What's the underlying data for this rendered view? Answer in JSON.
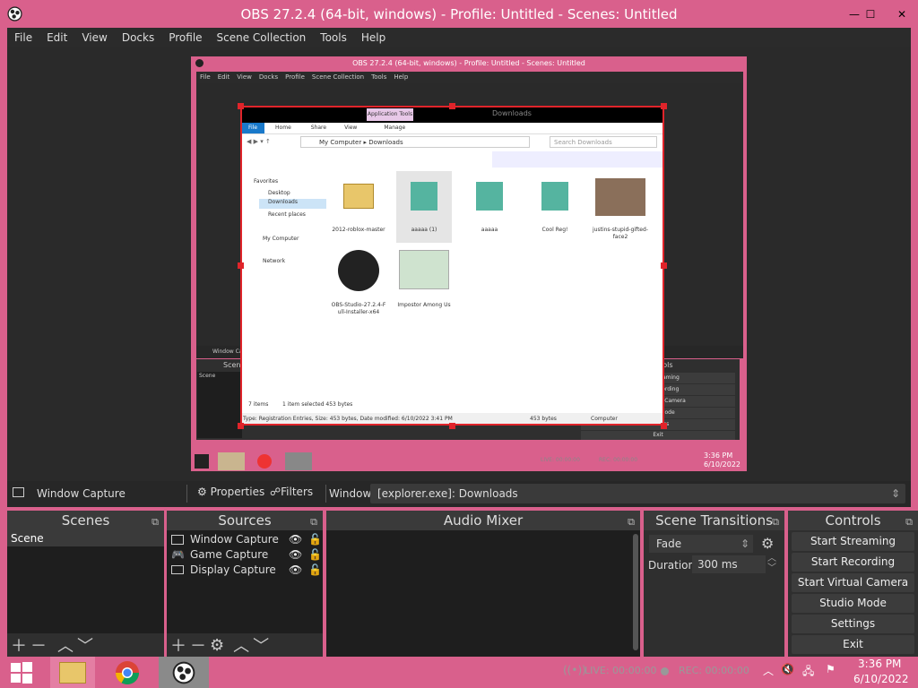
{
  "window": {
    "title": "OBS 27.2.4 (64-bit, windows) - Profile: Untitled - Scenes: Untitled",
    "minimize": "—",
    "maximize": "☐",
    "close": "✕"
  },
  "menu": [
    "File",
    "Edit",
    "View",
    "Docks",
    "Profile",
    "Scene Collection",
    "Tools",
    "Help"
  ],
  "preview": {
    "nested_title": "OBS 27.2.4 (64-bit, windows) - Profile: Untitled - Scenes: Untitled",
    "nested_menu": [
      "File",
      "Edit",
      "View",
      "Docks",
      "Profile",
      "Scene Collection",
      "Tools",
      "Help"
    ],
    "nested_window_capture": "Window Ca",
    "nested_scenes": "Scen",
    "nested_scene_item": "Scene",
    "nested_controls_title": "Controls",
    "nested_controls": [
      "Start Streaming",
      "Start Recording",
      "Start Virtual Camera",
      "Studio Mode",
      "Settings",
      "Exit"
    ],
    "nested_time": "3:36 PM",
    "nested_date": "6/10/2022",
    "nested_live": "LIVE: 00:00:00",
    "nested_rec": "REC: 00:00:00",
    "ribbon_context": "Application Tools",
    "ribbon_context2": "Downloads",
    "ribbon_tabs": [
      "File",
      "Home",
      "Share",
      "View",
      "Manage"
    ],
    "path_computer": "My Computer",
    "path_folder": "Downloads",
    "search_placeholder": "Search Downloads",
    "nav_favorites": "Favorites",
    "nav_items": [
      "Desktop",
      "Downloads",
      "Recent places"
    ],
    "nav_computer": "My Computer",
    "nav_network": "Network",
    "files": [
      {
        "name": "2012-roblox-master",
        "kind": "zip"
      },
      {
        "name": "aaaaa (1)",
        "kind": "reg"
      },
      {
        "name": "aaaaa",
        "kind": "reg"
      },
      {
        "name": "Cool Reg!",
        "kind": "reg"
      },
      {
        "name": "justins-stupid-gifted-face2",
        "kind": "photo"
      },
      {
        "name": "OBS-Studio-27.2.4-Full-Installer-x64",
        "kind": "obs"
      },
      {
        "name": "Impostor Among Us",
        "kind": "image"
      }
    ],
    "status_items": "7 items",
    "status_selected": "1 item selected  453 bytes",
    "details_bar": "Type: Registration Entries, Size: 453 bytes, Date modified: 6/10/2022 3:41 PM",
    "details_size": "453 bytes",
    "details_location": "Computer"
  },
  "sourcebar": {
    "source_name": "Window Capture",
    "properties": "Properties",
    "filters": "Filters",
    "window_label": "Window",
    "window_value": "[explorer.exe]: Downloads"
  },
  "scenes": {
    "title": "Scenes",
    "items": [
      "Scene"
    ]
  },
  "sources": {
    "title": "Sources",
    "items": [
      {
        "name": "Window Capture",
        "icon": "window-icon"
      },
      {
        "name": "Game Capture",
        "icon": "gamepad-icon"
      },
      {
        "name": "Display Capture",
        "icon": "monitor-icon"
      }
    ]
  },
  "mixer": {
    "title": "Audio Mixer"
  },
  "transitions": {
    "title": "Scene Transitions",
    "selected": "Fade",
    "duration_label": "Duration",
    "duration_value": "300 ms"
  },
  "controls": {
    "title": "Controls",
    "buttons": [
      "Start Streaming",
      "Start Recording",
      "Start Virtual Camera",
      "Studio Mode",
      "Settings",
      "Exit"
    ]
  },
  "status": {
    "live": "LIVE: 00:00:00",
    "rec": "REC: 00:00:00",
    "cpu": "CPU: 8.5%, 30.00 fps"
  },
  "taskbar": {
    "time": "3:36 PM",
    "date": "6/10/2022"
  },
  "colors": {
    "accent": "#d9608c",
    "panel": "#2f2f2f",
    "selection": "#e0242a"
  }
}
